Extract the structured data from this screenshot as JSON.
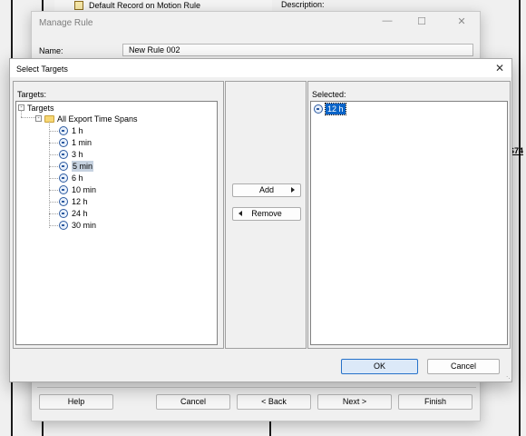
{
  "background": {
    "tree_item": "Default Record on Motion Rule",
    "description_label": "Description:",
    "side_text": "S74"
  },
  "manage_rule": {
    "title": "Manage Rule",
    "name_label": "Name:",
    "name_value": "New Rule 002",
    "buttons": {
      "help": "Help",
      "cancel": "Cancel",
      "back": "< Back",
      "next": "Next >",
      "finish": "Finish"
    }
  },
  "select_targets": {
    "title": "Select Targets",
    "targets_label": "Targets:",
    "selected_label": "Selected:",
    "tree": {
      "root": "Targets",
      "folder": "All Export Time Spans",
      "items": [
        "1 h",
        "1 min",
        "3 h",
        "5 min",
        "6 h",
        "10 min",
        "12 h",
        "24 h",
        "30 min"
      ],
      "highlighted_item": "5 min"
    },
    "selected_items": [
      "12 h"
    ],
    "add_label": "Add",
    "remove_label": "Remove",
    "ok_label": "OK",
    "cancel_label": "Cancel"
  }
}
